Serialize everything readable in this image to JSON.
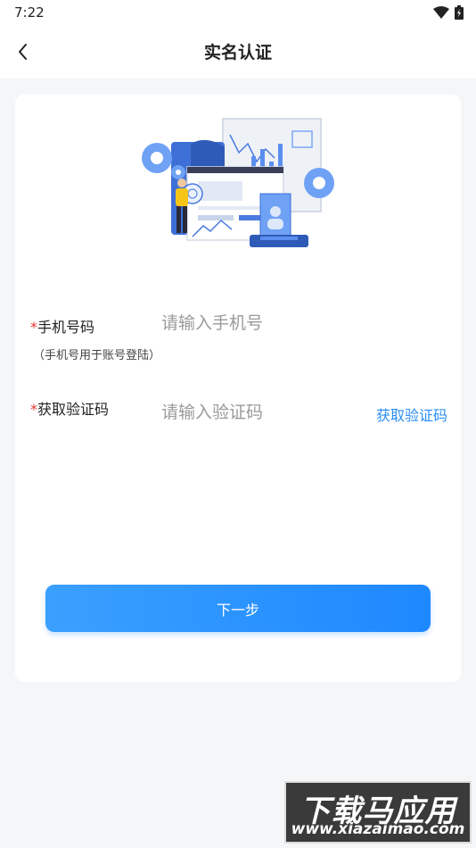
{
  "status_bar": {
    "time": "7:22"
  },
  "nav": {
    "title": "实名认证"
  },
  "form": {
    "required_mark": "*",
    "phone": {
      "label": "手机号码",
      "hint": "（手机号用于账号登陆）",
      "placeholder": "请输入手机号",
      "value": ""
    },
    "code": {
      "label": "获取验证码",
      "placeholder": "请输入验证码",
      "value": "",
      "get_code_link": "获取验证码"
    },
    "next_button": "下一步"
  },
  "colors": {
    "accent": "#2a8ef5",
    "required": "#e53935",
    "button_start": "#3aa0ff",
    "button_end": "#1e88ff"
  },
  "watermark": {
    "title": "下载马应用",
    "url": "www.xiazaimao.com"
  }
}
